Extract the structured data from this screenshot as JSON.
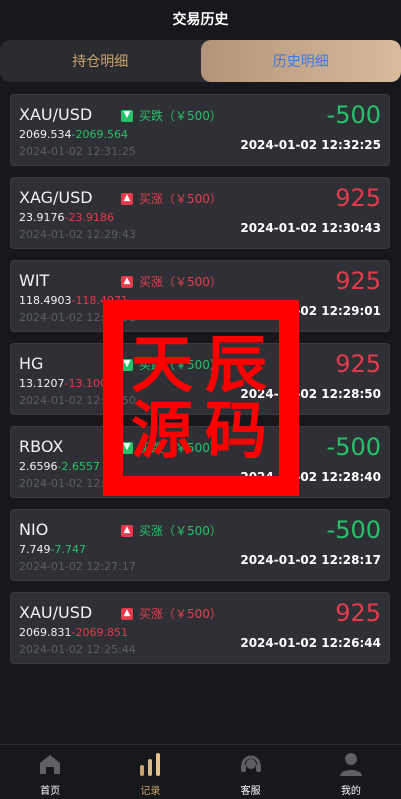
{
  "header": {
    "title": "交易历史"
  },
  "tabs": [
    {
      "label": "持仓明细",
      "active": false
    },
    {
      "label": "历史明细",
      "active": true
    }
  ],
  "trades": [
    {
      "symbol": "XAU/USD",
      "direction": "down",
      "action": "买跌（￥500）",
      "open_price": "2069.534",
      "close_price": "2069.564",
      "close_color": "green",
      "open_time": "2024-01-02 12:31:25",
      "pnl": "-500",
      "pnl_color": "green",
      "close_time": "2024-01-02 12:32:25"
    },
    {
      "symbol": "XAG/USD",
      "direction": "up",
      "action": "买涨（￥500）",
      "open_price": "23.9176",
      "close_price": "23.9186",
      "close_color": "red",
      "open_time": "2024-01-02 12:29:43",
      "pnl": "925",
      "pnl_color": "red",
      "close_time": "2024-01-02 12:30:43"
    },
    {
      "symbol": "WIT",
      "direction": "up",
      "action": "买涨（￥500）",
      "open_price": "118.4903",
      "close_price": "118.4971",
      "close_color": "red",
      "open_time": "2024-01-02 12:28:01",
      "pnl": "925",
      "pnl_color": "red",
      "close_time": "2024-01-02 12:29:01"
    },
    {
      "symbol": "HG",
      "direction": "down",
      "action": "买跌（￥500）",
      "open_price": "13.1207",
      "close_price": "13.1005",
      "close_color": "red",
      "open_time": "2024-01-02 12:27:50",
      "pnl": "925",
      "pnl_color": "red",
      "close_time": "2024-01-02 12:28:50"
    },
    {
      "symbol": "RBOX",
      "direction": "down",
      "action": "买跌（￥500）",
      "open_price": "2.6596",
      "close_price": "2.6557",
      "close_color": "green",
      "open_time": "2024-01-02 12:27:40",
      "pnl": "-500",
      "pnl_color": "green",
      "close_time": "2024-01-02 12:28:40"
    },
    {
      "symbol": "NIO",
      "direction": "up",
      "action": "买涨（￥500）",
      "action_color": "green",
      "open_price": "7.749",
      "close_price": "7.747",
      "close_color": "green",
      "open_time": "2024-01-02 12:27:17",
      "pnl": "-500",
      "pnl_color": "green",
      "close_time": "2024-01-02 12:28:17"
    },
    {
      "symbol": "XAU/USD",
      "direction": "up",
      "action": "买涨（￥500）",
      "open_price": "2069.831",
      "close_price": "2069.851",
      "close_color": "red",
      "open_time": "2024-01-02 12:25:44",
      "pnl": "925",
      "pnl_color": "red",
      "close_time": "2024-01-02 12:26:44"
    }
  ],
  "watermark": {
    "chars": [
      "天",
      "辰",
      "源",
      "码"
    ],
    "color": "#ff0000"
  },
  "nav": [
    {
      "label": "首页",
      "icon": "home-icon"
    },
    {
      "label": "记录",
      "icon": "bar-chart-icon",
      "current": true
    },
    {
      "label": "客服",
      "icon": "headset-icon"
    },
    {
      "label": "我的",
      "icon": "user-icon"
    }
  ],
  "colors": {
    "profit": "#e53a4b",
    "loss": "#27c169",
    "accent_gold": "#c9a46a",
    "active_tab_text": "#3b78e7"
  }
}
